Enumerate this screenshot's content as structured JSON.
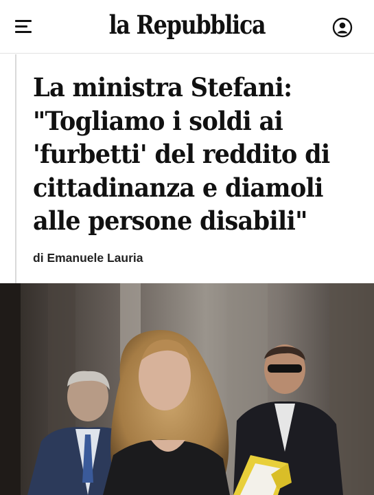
{
  "header": {
    "logo_text": "la Repubblica",
    "menu_icon": "hamburger-menu-icon",
    "account_icon": "user-account-icon"
  },
  "article": {
    "headline": "La ministra Stefani: \"Togliamo i soldi ai 'furbetti' del reddito di cittadinanza e diamoli alle persone disabili\"",
    "byline_prefix": "di",
    "author": "Emanuele Lauria"
  },
  "colors": {
    "text": "#111111",
    "divider": "#e2e2e2",
    "accent_rule": "#d9d9d9"
  }
}
